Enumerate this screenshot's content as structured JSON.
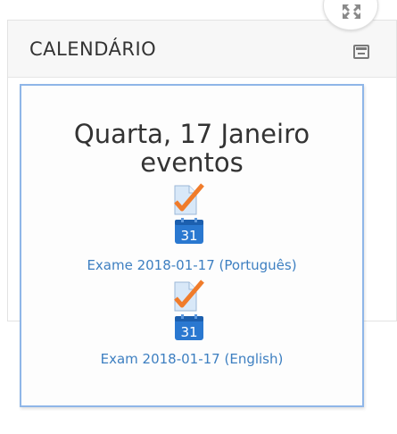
{
  "block": {
    "title": "CALENDÁRIO"
  },
  "popup": {
    "title_line1": "Quarta, 17 Janeiro",
    "title_line2": "eventos",
    "events": [
      {
        "label": "Exame 2018-01-17 (Português)",
        "calendar_day": "31"
      },
      {
        "label": "Exam 2018-01-17 (English)",
        "calendar_day": "31"
      }
    ]
  },
  "colors": {
    "link": "#3d7fc1",
    "popup_border": "#8fb6e8",
    "check": "#f07c2b",
    "calendar": "#2a78d0"
  },
  "icons": {
    "fullscreen": "expand-arrows-icon",
    "collapse": "minimize-window-icon",
    "event": "assignment-check-icon",
    "calendar": "calendar-icon"
  }
}
